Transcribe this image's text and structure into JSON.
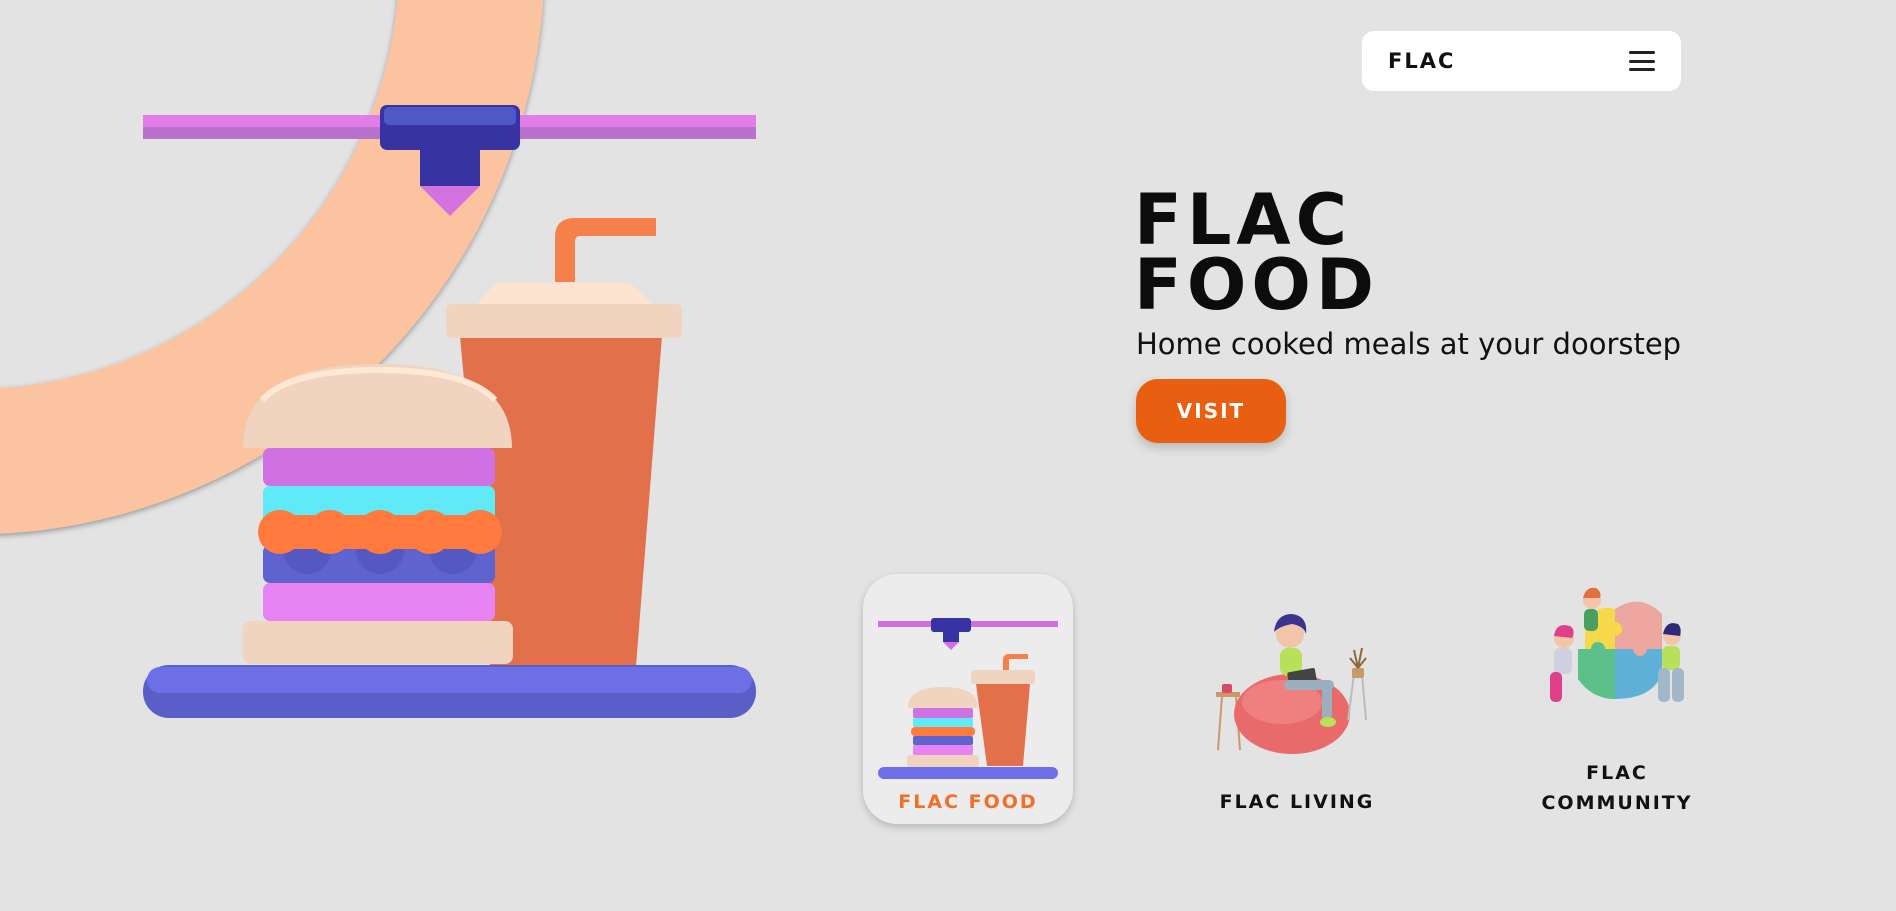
{
  "nav": {
    "brand": "FLAC",
    "menu_icon": "hamburger-menu-icon"
  },
  "hero": {
    "title_line1": "FLAC",
    "title_line2": "FOOD",
    "tagline": "Home cooked meals at your doorstep",
    "visit_label": "VISIT",
    "illustration": "3d-printer-burger-drink"
  },
  "cards": [
    {
      "label": "FLAC FOOD",
      "icon": "burger-drink-printer-icon",
      "active": true
    },
    {
      "label": "FLAC LIVING",
      "icon": "woman-beanbag-laptop-icon",
      "active": false
    },
    {
      "label_line1": "FLAC",
      "label_line2": "COMMUNITY",
      "icon": "people-puzzle-icon",
      "active": false
    }
  ],
  "colors": {
    "background": "#e3e3e3",
    "accent": "#e95f12",
    "active_label": "#f06f2a",
    "printer_rail": "#d46ee8",
    "printer_head": "#3730a3",
    "tray": "#6c6fe6",
    "cup": "#e2704a",
    "ring": "#fbc39f"
  }
}
